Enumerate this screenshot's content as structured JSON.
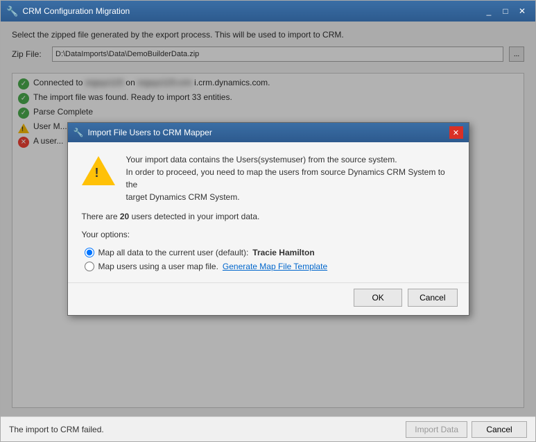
{
  "window": {
    "title": "CRM Configuration Migration",
    "icon": "🔧"
  },
  "main": {
    "description": "Select the zipped file generated by the export process. This will be used to import to CRM.",
    "zip_label": "Zip File:",
    "zip_value": "D:\\DataImports\\Data\\DemoBuilderData.zip",
    "browse_label": "..."
  },
  "status_messages": [
    {
      "type": "check",
      "text_prefix": "Connected to",
      "blurred": "orgxyz123",
      "text_middle": "on",
      "blurred2": "orgxyz123.crm",
      "text_suffix": "i.crm.dynamics.com."
    },
    {
      "type": "check",
      "text": "The import file was found. Ready to import 33 entities."
    },
    {
      "type": "check",
      "text": "Parse Complete"
    },
    {
      "type": "warning",
      "text": "User M..."
    },
    {
      "type": "error",
      "text": "A user..."
    }
  ],
  "bottom": {
    "status": "The import to CRM failed.",
    "import_btn": "Import Data",
    "cancel_btn": "Cancel"
  },
  "modal": {
    "title": "Import File Users to CRM Mapper",
    "icon": "🔧",
    "message_line1": "Your import data contains the Users(systemuser) from the source system.",
    "message_line2": "In order to proceed, you need to map the users from source Dynamics CRM System to the",
    "message_line3": "target Dynamics CRM System.",
    "count_prefix": "There are",
    "count_number": "20",
    "count_suffix": "users detected in your import data.",
    "options_label": "Your options:",
    "option1_label": "Map all data to the current user (default):",
    "option1_name": "Tracie Hamilton",
    "option2_label": "Map users using a user map file.",
    "generate_link": "Generate Map File Template",
    "ok_btn": "OK",
    "cancel_btn": "Cancel"
  }
}
